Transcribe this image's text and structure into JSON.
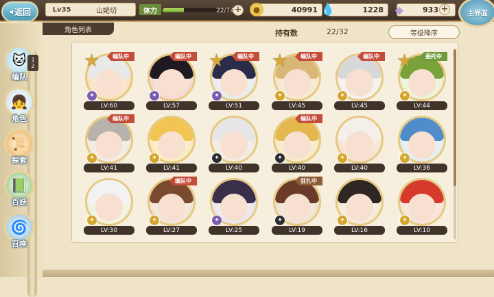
{
  "header": {
    "back_label": "返回",
    "level": "Lv35",
    "player_name": "山姥切",
    "stamina_label": "体力",
    "stamina_value": "22/74",
    "stamina_fraction": 0.3,
    "gold": "40991",
    "water": "1228",
    "crystal": "933",
    "main_label": "主界面"
  },
  "subheader": {
    "tab": "角色列表",
    "owned_label": "持有数",
    "owned_count": "22/32",
    "sort_label": "等级降序"
  },
  "nav": [
    {
      "label": "编队",
      "icon": "formation-icon",
      "badge_top": "1",
      "badge_bottom": "2",
      "color": "#9ed3e6"
    },
    {
      "label": "角色",
      "icon": "character-icon",
      "color": "#c8e0ec"
    },
    {
      "label": "探索",
      "icon": "explore-icon",
      "color": "#e9a948"
    },
    {
      "label": "百妖",
      "icon": "yokai-book-icon",
      "color": "#8cc07a"
    },
    {
      "label": "召唤",
      "icon": "summon-icon",
      "color": "#8abbd9"
    }
  ],
  "characters": [
    {
      "level": "LV:60",
      "tag": "编队中",
      "tag_type": "red",
      "star": true,
      "hair": "#e9e9e9",
      "bg": "#f2d7a8",
      "elem": "#7a5db0"
    },
    {
      "level": "LV:57",
      "tag": "编队中",
      "tag_type": "red",
      "star": false,
      "hair": "#1f1a22",
      "bg": "#f3c9c3",
      "elem": "#7a5db0"
    },
    {
      "level": "LV:51",
      "tag": "编队中",
      "tag_type": "red",
      "star": true,
      "hair": "#2a2c4a",
      "bg": "#dfe4ef",
      "elem": "#7a5db0"
    },
    {
      "level": "LV:45",
      "tag": "编队中",
      "tag_type": "red",
      "star": true,
      "hair": "#d9b877",
      "bg": "#f0dfc0",
      "elem": "#d4a62d"
    },
    {
      "level": "LV:45",
      "tag": "编队中",
      "tag_type": "red",
      "star": false,
      "hair": "#d8d8d8",
      "bg": "#eeeeee",
      "elem": "#d4a62d"
    },
    {
      "level": "LV:44",
      "tag": "委托中",
      "tag_type": "green",
      "star": true,
      "hair": "#7aa23a",
      "bg": "#e3efc8",
      "elem": "#d4a62d"
    },
    {
      "level": "LV:41",
      "tag": "编队中",
      "tag_type": "red",
      "star": false,
      "hair": "#b7b2ab",
      "bg": "#eae4da",
      "elem": "#d4a62d"
    },
    {
      "level": "LV:41",
      "tag": "",
      "tag_type": "",
      "star": false,
      "hair": "#f1c453",
      "bg": "#f6e2a8",
      "elem": "#d4a62d"
    },
    {
      "level": "LV:40",
      "tag": "",
      "tag_type": "",
      "star": false,
      "hair": "#e6e6e6",
      "bg": "#e9e5dd",
      "elem": "#2d2d2d"
    },
    {
      "level": "LV:40",
      "tag": "编队中",
      "tag_type": "red",
      "star": false,
      "hair": "#e5b84d",
      "bg": "#f4e2b2",
      "elem": "#2d2d2d"
    },
    {
      "level": "LV:40",
      "tag": "",
      "tag_type": "",
      "star": false,
      "hair": "#f4efe8",
      "bg": "#f3d6c6",
      "elem": "#d4a62d"
    },
    {
      "level": "LV:36",
      "tag": "",
      "tag_type": "",
      "star": false,
      "hair": "#4f8cc9",
      "bg": "#d5e6f1",
      "elem": "#d4a62d"
    },
    {
      "level": "LV:30",
      "tag": "",
      "tag_type": "",
      "star": false,
      "hair": "#f2f2f2",
      "bg": "#e7efd6",
      "elem": "#d4a62d"
    },
    {
      "level": "LV:27",
      "tag": "编队中",
      "tag_type": "red",
      "star": false,
      "hair": "#7a4a2e",
      "bg": "#eadbc9",
      "elem": "#d4a62d"
    },
    {
      "level": "LV:25",
      "tag": "",
      "tag_type": "",
      "star": false,
      "hair": "#3a2f4a",
      "bg": "#e0dceb",
      "elem": "#7a5db0"
    },
    {
      "level": "LV:19",
      "tag": "驻扎中",
      "tag_type": "brown",
      "star": false,
      "hair": "#6a3b28",
      "bg": "#ead6c6",
      "elem": "#2d2d2d"
    },
    {
      "level": "LV:16",
      "tag": "",
      "tag_type": "",
      "star": false,
      "hair": "#2e2622",
      "bg": "#efe2cc",
      "elem": "#d4a62d"
    },
    {
      "level": "LV:10",
      "tag": "",
      "tag_type": "",
      "star": false,
      "hair": "#d63a2c",
      "bg": "#f3d8cc",
      "elem": "#d4a62d"
    }
  ]
}
